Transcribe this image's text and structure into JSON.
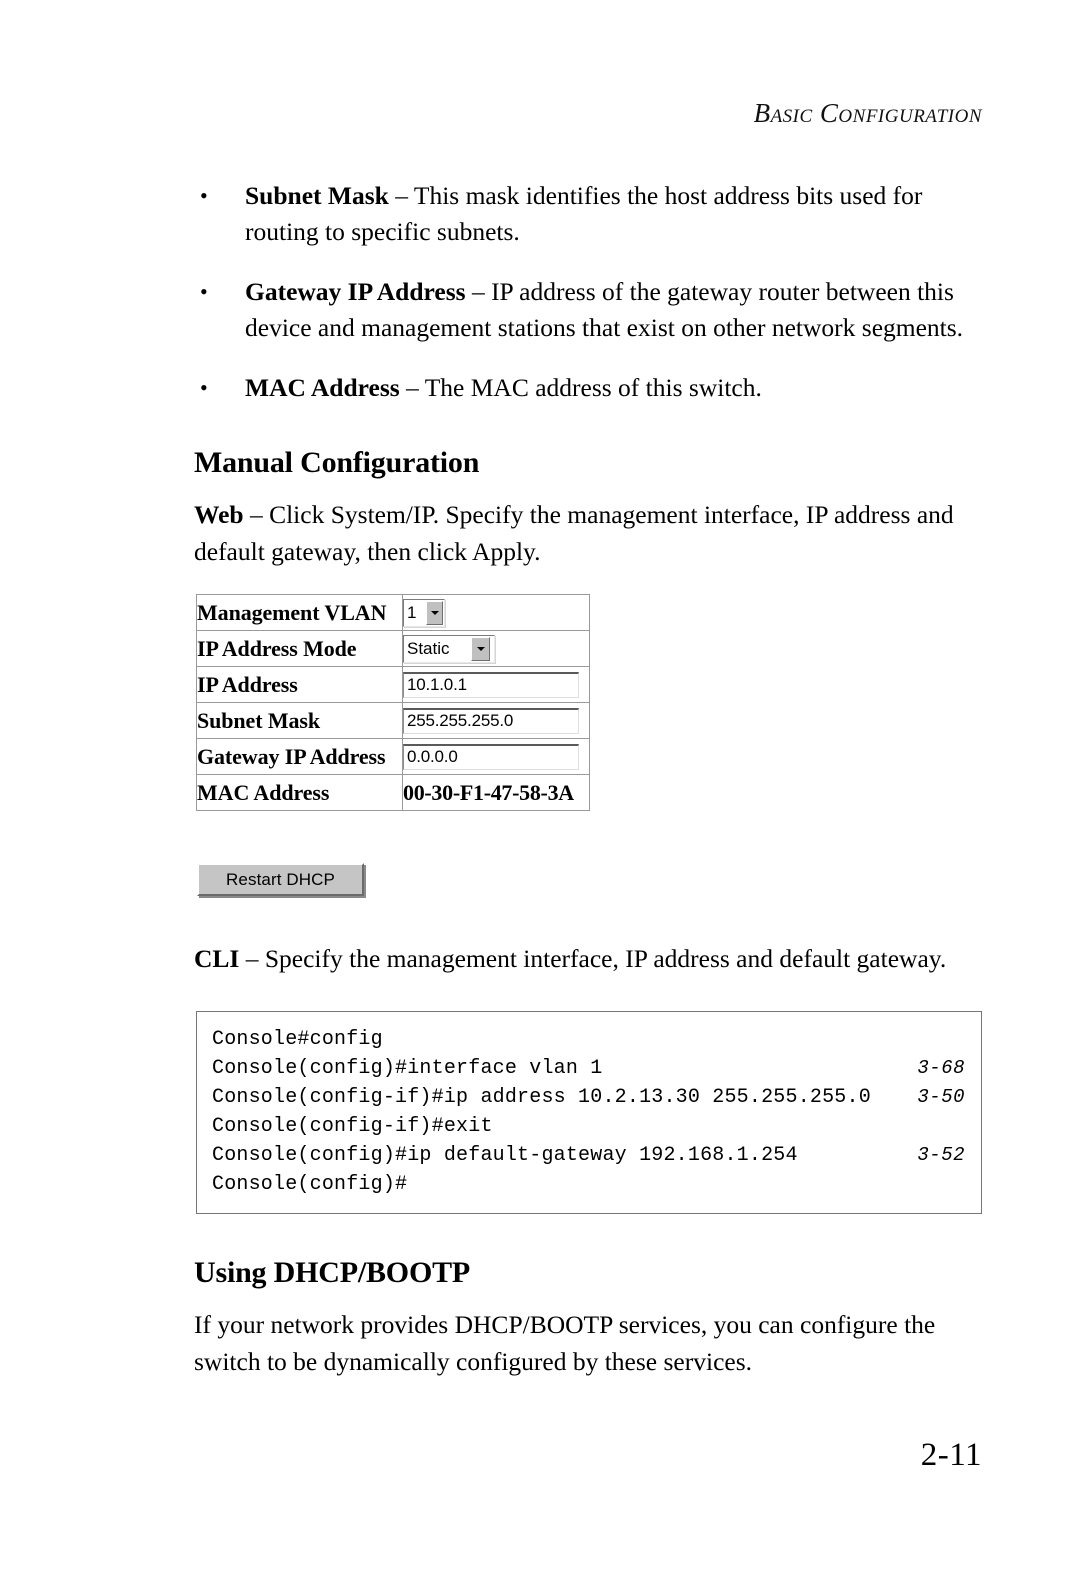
{
  "header": {
    "running_head": "Basic Configuration"
  },
  "bullets": [
    {
      "term": "Subnet Mask",
      "dash": " – ",
      "text": "This mask identifies the host address bits used for routing to specific subnets.",
      "marker": "•"
    },
    {
      "term": "Gateway IP Address",
      "dash": " – ",
      "text": "IP address of the gateway router between this device and management stations that exist on other network segments.",
      "marker": "•"
    },
    {
      "term": "MAC Address",
      "dash": " – ",
      "text": "The MAC address of this switch.",
      "marker": "•"
    }
  ],
  "sections": {
    "manual_configuration": {
      "heading": "Manual Configuration",
      "web_label": "Web",
      "web_dash": " – ",
      "web_text": "Click System/IP. Specify the management interface, IP address and default gateway, then click Apply.",
      "cli_label": "CLI",
      "cli_dash": " – ",
      "cli_text": "Specify the management interface, IP address and default gateway."
    },
    "using_dhcp": {
      "heading_part1": "Using ",
      "heading_part2": "DHCP/BOOTP",
      "body": "If your network provides DHCP/BOOTP services, you can configure the switch to be dynamically configured by these services."
    }
  },
  "config_form": {
    "rows": [
      {
        "label": "Management VLAN",
        "type": "select",
        "value": "1"
      },
      {
        "label": "IP Address Mode",
        "type": "select",
        "value": "Static"
      },
      {
        "label": "IP Address",
        "type": "text",
        "value": "10.1.0.1"
      },
      {
        "label": "Subnet Mask",
        "type": "text",
        "value": "255.255.255.0"
      },
      {
        "label": "Gateway IP Address",
        "type": "text",
        "value": "0.0.0.0"
      },
      {
        "label": "MAC Address",
        "type": "static",
        "value": "00-30-F1-47-58-3A"
      }
    ],
    "restart_button": "Restart DHCP"
  },
  "cli_block": {
    "lines": [
      {
        "command": "Console#config",
        "ref": ""
      },
      {
        "command": "Console(config)#interface vlan 1",
        "ref": "3-68"
      },
      {
        "command": "Console(config-if)#ip address 10.2.13.30 255.255.255.0",
        "ref": "3-50"
      },
      {
        "command": "Console(config-if)#exit",
        "ref": ""
      },
      {
        "command": "Console(config)#ip default-gateway 192.168.1.254",
        "ref": "3-52"
      },
      {
        "command": "Console(config)#",
        "ref": ""
      }
    ]
  },
  "footer": {
    "page_number": "2-11"
  }
}
